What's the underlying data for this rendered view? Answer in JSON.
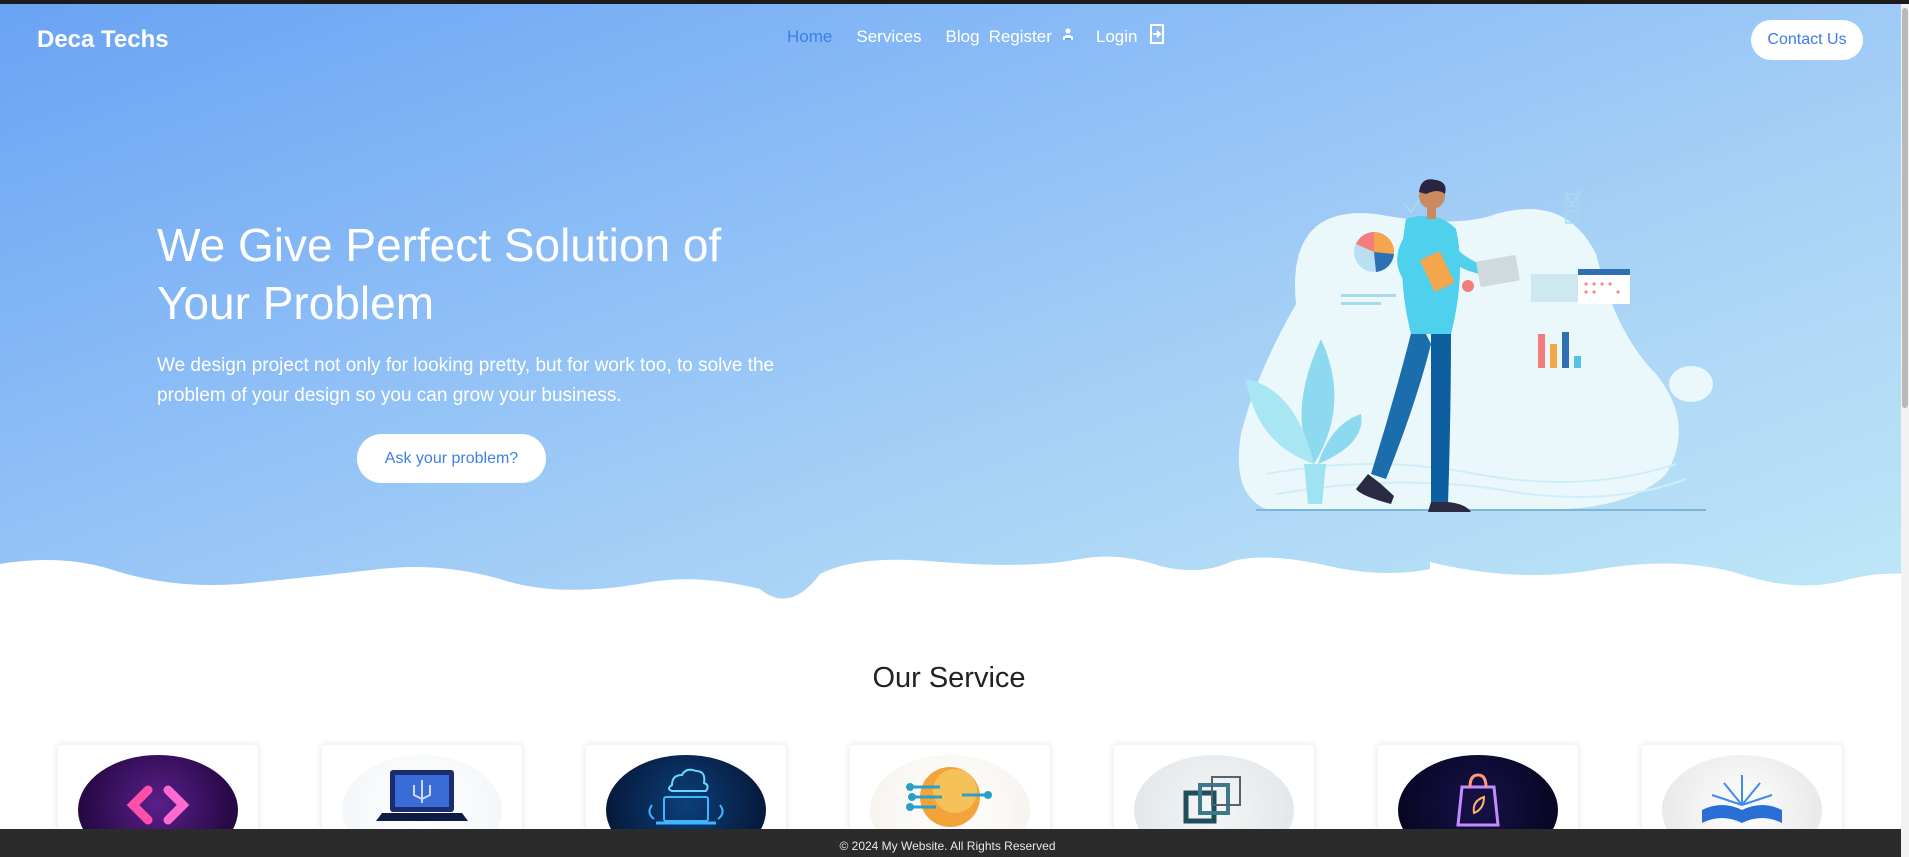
{
  "brand": "Deca Techs",
  "nav": {
    "home": "Home",
    "services": "Services",
    "blog": "Blog",
    "register": "Register",
    "login": "Login"
  },
  "contact_label": "Contact Us",
  "hero": {
    "title": "We Give Perfect Solution of Your Problem",
    "description": "We design project not only for looking pretty, but for work too, to solve the problem of your design so you can grow your business.",
    "cta": "Ask your problem?"
  },
  "services": {
    "title": "Our Service",
    "items": [
      {
        "icon": "code-icon"
      },
      {
        "icon": "computer-icon"
      },
      {
        "icon": "cloud-laptop-icon"
      },
      {
        "icon": "ai-brain-icon"
      },
      {
        "icon": "layers-icon"
      },
      {
        "icon": "shopping-bag-icon"
      },
      {
        "icon": "open-book-icon"
      }
    ]
  },
  "footer": "© 2024 My Website. All Rights Reserved",
  "colors": {
    "accent": "#3f7fe6",
    "hero_start": "#6aa3f4",
    "hero_end": "#bfe8f7"
  }
}
